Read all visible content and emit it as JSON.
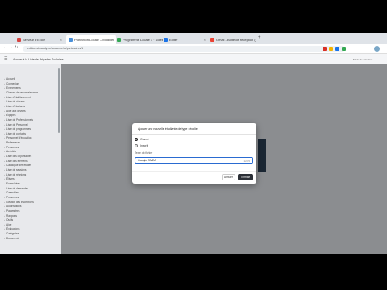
{
  "browser": {
    "tabs": [
      {
        "label": "Serveur d'Ecole",
        "favicon_color": "#d64541"
      },
      {
        "label": "Protection Locale – Modifier",
        "favicon_color": "#4a90d9"
      },
      {
        "label": "Programme Locale 1 · ScreenS...",
        "favicon_color": "#34a853"
      },
      {
        "label": "Editer",
        "favicon_color": "#1a73e8"
      },
      {
        "label": "Gmail - Boite de réception (1)",
        "favicon_color": "#ea4335"
      }
    ],
    "url": "edition.stmaddy.cc/scolarme/fo/partenaires/1"
  },
  "app": {
    "title": "Ajouter à la Liste de Brigades Scolaires",
    "top_right": "Mode de sélection"
  },
  "sidebar": {
    "items": [
      "Accueil",
      "Connexion",
      "Evénements",
      "Classes de reconnaissance",
      "Liste d'établissement",
      "Liste de classes",
      "Liste d'étudiants",
      "Aide aux devoirs",
      "Équipes",
      "Liste de Professionnels",
      "Liste de Personnel",
      "Liste de programmes",
      "Liste de contacts",
      "Personnel d'éducation",
      "Professeurs",
      "Personnes",
      "Activités",
      "Liste des opportunités",
      "Liste des éléments",
      "Catalogue des études",
      "Liste de sessions",
      "Liste de réunions",
      "Élèves",
      "Formulaires",
      "Liste de demandes",
      "Calendrier",
      "Présences",
      "Gestion des inscriptions",
      "Autorisations",
      "Paramètres",
      "Rapports",
      "Outils",
      "Aide",
      "Évaluations",
      "Catégories",
      "Documents"
    ]
  },
  "modal": {
    "title": "Ajouter une nouvelle étudiante de type : écolier",
    "options": [
      {
        "label": "Ouvert",
        "selected": true
      },
      {
        "label": "Inscrit",
        "selected": false
      }
    ],
    "field_label": "Texte du fichier",
    "field_value": "Google GMEA",
    "field_counter": "12/25",
    "cancel_label": "Annuler",
    "save_label": "Terminé"
  },
  "colors": {
    "overlay": "#8b8d90",
    "primary_button": "#2b2f36",
    "focus_border": "#2a6bd1"
  }
}
